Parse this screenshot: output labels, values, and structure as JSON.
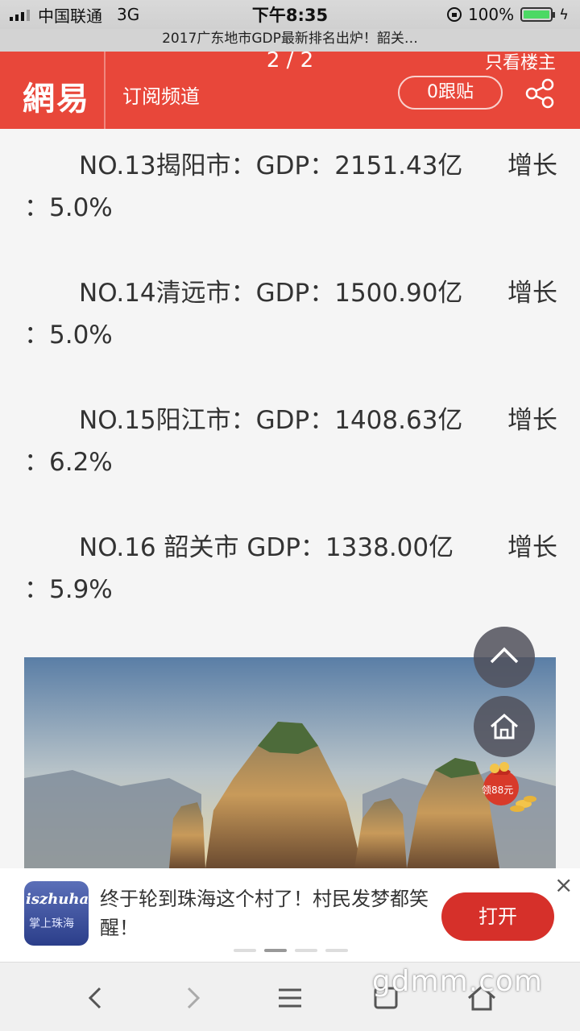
{
  "status_bar": {
    "carrier": "中国联通",
    "network": "3G",
    "time": "下午8:35",
    "battery": "100%"
  },
  "browser": {
    "page_title": "2017广东地市GDP最新排名出炉！韶关…"
  },
  "header": {
    "page_indicator": "2 / 2",
    "only_op": "只看楼主",
    "logo": "網易",
    "subscribe": "订阅频道",
    "comments": "0跟贴"
  },
  "article": {
    "items": [
      {
        "line1_left": "NO.13揭阳市：GDP：2151.43亿",
        "line1_right": "增长",
        "line2": "：5.0%"
      },
      {
        "line1_left": "NO.14清远市：GDP：1500.90亿",
        "line1_right": "增长",
        "line2": "：5.0%"
      },
      {
        "line1_left": "NO.15阳江市：GDP：1408.63亿",
        "line1_right": "增长",
        "line2": "：6.2%"
      },
      {
        "line1_left": "NO.16 韶关市 GDP：1338.00亿",
        "line1_right": "增长",
        "line2": "：5.9%"
      }
    ]
  },
  "float": {
    "coin_badge": "领88元"
  },
  "ad": {
    "logo_text": "iszhuhai",
    "logo_sub": "掌上珠海",
    "text": "终于轮到珠海这个村了！村民发梦都笑醒！",
    "open_label": "打开",
    "close": "×"
  },
  "watermark": "gdmm.com"
}
